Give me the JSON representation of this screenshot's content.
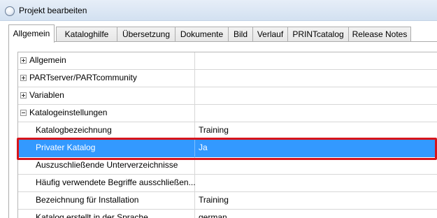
{
  "window": {
    "title": "Projekt bearbeiten",
    "icon": "app-globe-icon"
  },
  "tabs": [
    {
      "label": "Allgemein",
      "active": true
    },
    {
      "label": "Kataloghilfe",
      "active": false
    },
    {
      "label": "Übersetzung",
      "active": false
    },
    {
      "label": "Dokumente",
      "active": false
    },
    {
      "label": "Bild",
      "active": false
    },
    {
      "label": "Verlauf",
      "active": false
    },
    {
      "label": "PRINTcatalog",
      "active": false
    },
    {
      "label": "Release Notes",
      "active": false
    }
  ],
  "grid": {
    "rows": [
      {
        "name": "Allgemein",
        "value": "",
        "expander": "plus"
      },
      {
        "name": "PARTserver/PARTcommunity",
        "value": "",
        "expander": "plus"
      },
      {
        "name": "Variablen",
        "value": "",
        "expander": "plus"
      },
      {
        "name": "Katalogeinstellungen",
        "value": "",
        "expander": "minus"
      },
      {
        "name": "Katalogbezeichnung",
        "value": "Training"
      },
      {
        "name": "Privater Katalog",
        "value": "Ja",
        "selected": true
      },
      {
        "name": "Auszuschließende Unterverzeichnisse",
        "value": ""
      },
      {
        "name": "Häufig verwendete Begriffe ausschließen...",
        "value": ""
      },
      {
        "name": "Bezeichnung für Installation",
        "value": "Training"
      },
      {
        "name": "Katalog erstellt in der Sprache",
        "value": "german"
      }
    ]
  },
  "colors": {
    "selection": "#3399ff",
    "highlight_frame": "#d7141b"
  }
}
